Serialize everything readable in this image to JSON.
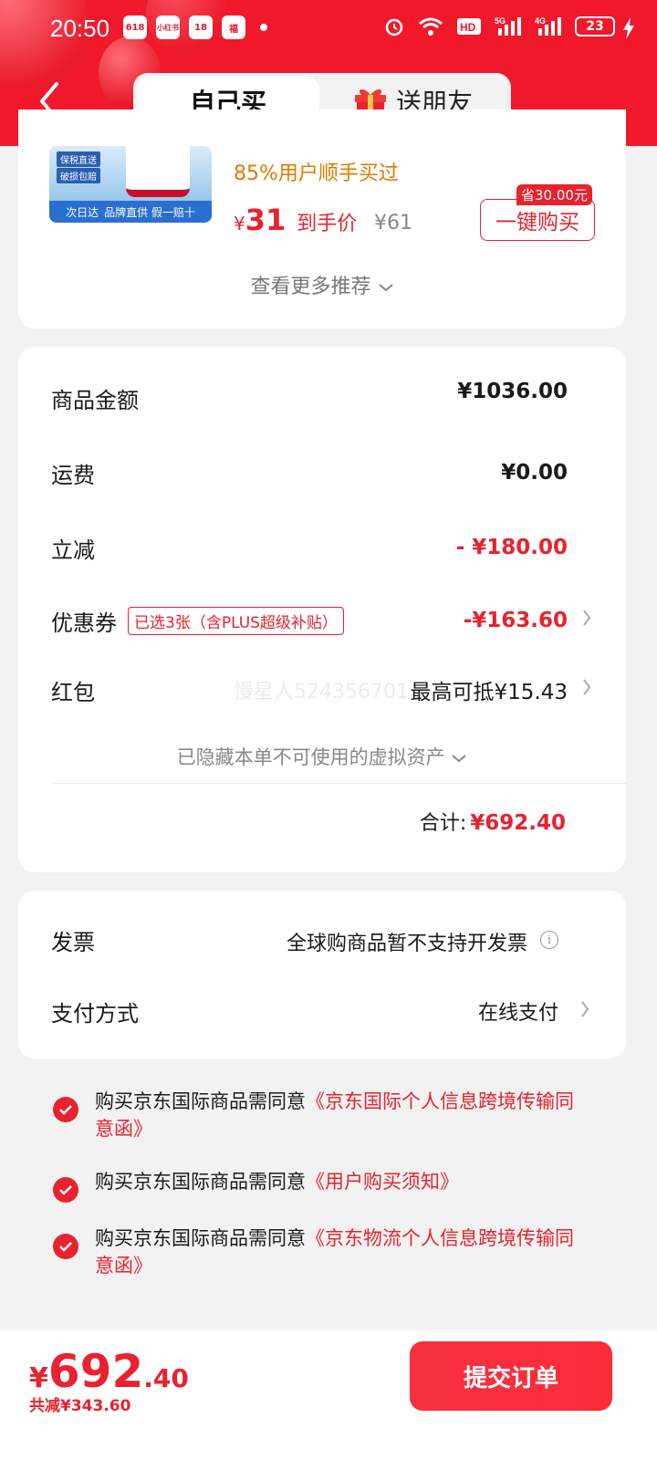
{
  "status_bar": {
    "time": "20:50",
    "battery": "23",
    "mini_apps": [
      "618",
      "小红书",
      "18",
      "福"
    ]
  },
  "header": {
    "tab_self": "自己买",
    "tab_gift": "送朋友"
  },
  "recommendation": {
    "users_bought": "85%用户顺手买过",
    "currency": "¥",
    "price": "31",
    "price_label": "到手价",
    "original_price": "¥61",
    "save_tag": "省30.00元",
    "buy_button": "一键购买",
    "more": "查看更多推荐",
    "image_tags": [
      "保税直送",
      "破损包赔"
    ],
    "image_bottom": "品牌直供 假一赔十",
    "image_logo": "次日达"
  },
  "summary": {
    "goods_label": "商品金额",
    "goods_value": "¥1036.00",
    "shipping_label": "运费",
    "shipping_value": "¥0.00",
    "discount_label": "立减",
    "discount_value": "- ¥180.00",
    "coupon_label": "优惠券",
    "coupon_tag": "已选3张（含PLUS超级补贴）",
    "coupon_value": "-¥163.60",
    "redpacket_label": "红包",
    "redpacket_watermark": "慢星人524356701",
    "redpacket_value": "最高可抵¥15.43",
    "hidden_note": "已隐藏本单不可使用的虚拟资产",
    "total_label": "合计:",
    "total_value": "¥692.40"
  },
  "invoice": {
    "invoice_label": "发票",
    "invoice_value": "全球购商品暂不支持开发票",
    "payment_label": "支付方式",
    "payment_value": "在线支付"
  },
  "agreements": [
    {
      "text": "购买京东国际商品需同意",
      "link": "《京东国际个人信息跨境传输同意函》"
    },
    {
      "text": "购买京东国际商品需同意",
      "link": "《用户购买须知》"
    },
    {
      "text": "购买京东国际商品需同意",
      "link": "《京东物流个人信息跨境传输同意函》"
    }
  ],
  "bottom_bar": {
    "currency": "¥",
    "price_int": "692",
    "price_dec": ".40",
    "saved": "共减¥343.60",
    "submit": "提交订单"
  },
  "colors": {
    "brand_red": "#f0182a",
    "price_red": "#e8222e",
    "accent_orange": "#e07a00"
  }
}
